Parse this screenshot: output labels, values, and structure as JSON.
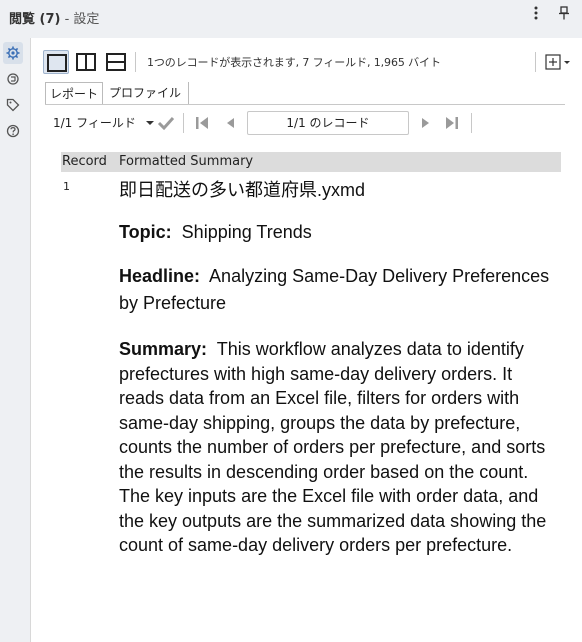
{
  "window": {
    "title_main": "閲覧 (7)",
    "title_sub": "- 設定",
    "menu_icon": "vertical-dots-icon",
    "pin_icon": "pin-icon"
  },
  "rail": {
    "items": [
      {
        "name": "gear-icon",
        "active": true
      },
      {
        "name": "refresh-icon",
        "active": false
      },
      {
        "name": "tag-icon",
        "active": false
      },
      {
        "name": "help-icon",
        "active": false
      }
    ]
  },
  "toolbar": {
    "record_info": "1つのレコードが表示されます, 7 フィールド, 1,965 バイト"
  },
  "tabs": [
    {
      "label": "レポート",
      "active": true
    },
    {
      "label": "プロファイル",
      "active": false
    }
  ],
  "nav": {
    "fields_label": "1/1 フィールド",
    "record_position": "1/1 のレコード"
  },
  "report": {
    "columns": [
      "Record",
      "Formatted Summary"
    ],
    "row_number": "1",
    "filename": "即日配送の多い都道府県.yxmd",
    "topic_label": "Topic:",
    "topic_value": "Shipping Trends",
    "headline_label": "Headline:",
    "headline_value": "Analyzing Same-Day Delivery Preferences by Prefecture",
    "summary_label": "Summary:",
    "summary_value": "This workflow analyzes data to identify prefectures with high same-day delivery orders. It reads data from an Excel file, filters for orders with same-day shipping, groups the data by prefecture, counts the number of orders per prefecture, and sorts the results in descending order based on the count. The key inputs are the Excel file with order data, and the key outputs are the summarized data showing the count of same-day delivery orders per prefecture."
  },
  "colors": {
    "accent": "#3b6fb6",
    "header_bg": "#dcdcdc"
  }
}
